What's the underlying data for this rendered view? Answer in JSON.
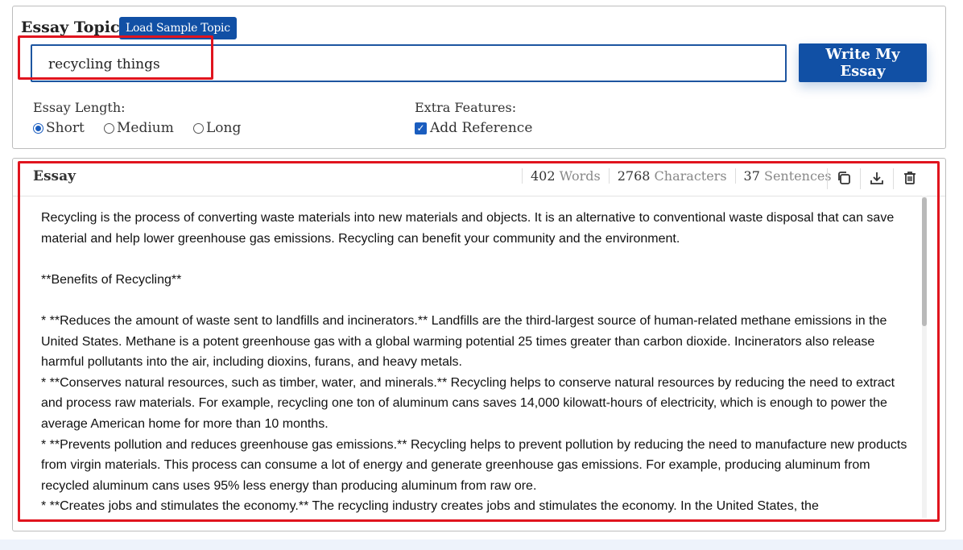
{
  "topic": {
    "label": "Essay Topic:",
    "sample_button": "Load Sample Topic",
    "input_value": "recycling things",
    "write_button": "Write My Essay"
  },
  "options": {
    "length_label": "Essay Length:",
    "lengths": [
      {
        "label": "Short",
        "checked": true
      },
      {
        "label": "Medium",
        "checked": false
      },
      {
        "label": "Long",
        "checked": false
      }
    ],
    "extra_label": "Extra Features:",
    "add_reference": {
      "label": "Add Reference",
      "checked": true
    }
  },
  "essay": {
    "title": "Essay",
    "stats": {
      "words_num": "402",
      "words_unit": "Words",
      "chars_num": "2768",
      "chars_unit": "Characters",
      "sentences_num": "37",
      "sentences_unit": "Sentences"
    },
    "icons": [
      "copy-icon",
      "download-icon",
      "trash-icon"
    ],
    "paragraphs": [
      "Recycling is the process of converting waste materials into new materials and objects. It is an alternative to conventional waste disposal that can save material and help lower greenhouse gas emissions. Recycling can benefit your community and the environment.",
      "",
      "**Benefits of Recycling**",
      "",
      "* **Reduces the amount of waste sent to landfills and incinerators.** Landfills are the third-largest source of human-related methane emissions in the United States. Methane is a potent greenhouse gas with a global warming potential 25 times greater than carbon dioxide. Incinerators also release harmful pollutants into the air, including dioxins, furans, and heavy metals.",
      "* **Conserves natural resources, such as timber, water, and minerals.** Recycling helps to conserve natural resources by reducing the need to extract and process raw materials. For example, recycling one ton of aluminum cans saves 14,000 kilowatt-hours of electricity, which is enough to power the average American home for more than 10 months.",
      "* **Prevents pollution and reduces greenhouse gas emissions.** Recycling helps to prevent pollution by reducing the need to manufacture new products from virgin materials. This process can consume a lot of energy and generate greenhouse gas emissions. For example, producing aluminum from recycled aluminum cans uses 95% less energy than producing aluminum from raw ore.",
      "* **Creates jobs and stimulates the economy.** The recycling industry creates jobs and stimulates the economy. In the United States, the"
    ]
  },
  "colors": {
    "accent": "#1150a5",
    "highlight": "#e0141e"
  }
}
